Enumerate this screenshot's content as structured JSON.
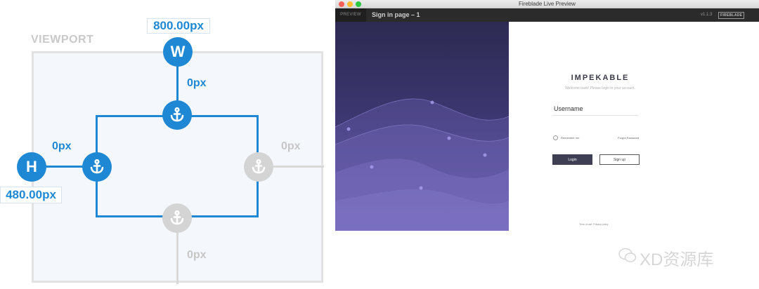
{
  "diagram": {
    "viewport_label": "VIEWPORT",
    "width_value": "800.00px",
    "height_value": "480.00px",
    "top_offset": "0px",
    "left_offset": "0px",
    "right_offset": "0px",
    "bottom_offset": "0px",
    "width_handle": "W",
    "height_handle": "H"
  },
  "window": {
    "title": "Fireblade Live Preview",
    "preview_tab": "PREVIEW",
    "document_title": "Sign in page – 1",
    "version": "v1.1.3",
    "brand": "FIREBLADE"
  },
  "login": {
    "brand_title": "IMPEKABLE",
    "welcome": "Welcome back! Please login to your account.",
    "username_placeholder": "Username",
    "remember_label": "Remember me",
    "forgot_label": "Forgot Password",
    "login_label": "Login",
    "signup_label": "Sign up",
    "terms": "Term of use. Privacy policy"
  },
  "watermark": "XD资源库"
}
